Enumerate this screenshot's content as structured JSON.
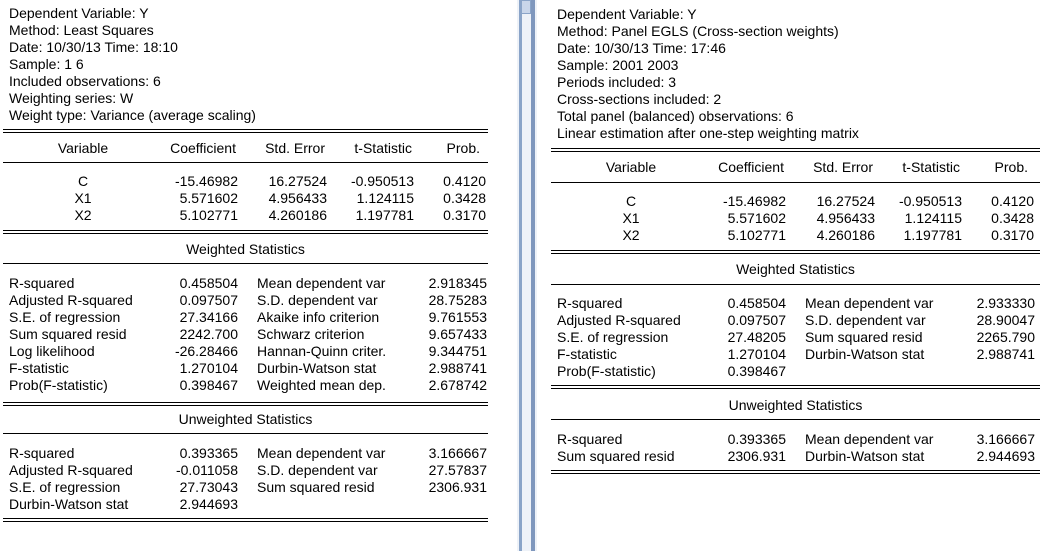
{
  "left": {
    "header": [
      "Dependent Variable: Y",
      "Method: Least Squares",
      "Date: 10/30/13   Time: 18:10",
      "Sample: 1 6",
      "Included observations: 6",
      "Weighting series: W",
      "Weight type: Variance (average scaling)"
    ],
    "columns": [
      "Variable",
      "Coefficient",
      "Std. Error",
      "t-Statistic",
      "Prob."
    ],
    "coef_rows": [
      [
        "C",
        "-15.46982",
        "16.27524",
        "-0.950513",
        "0.4120"
      ],
      [
        "X1",
        "5.571602",
        "4.956433",
        "1.124115",
        "0.3428"
      ],
      [
        "X2",
        "5.102771",
        "4.260186",
        "1.197781",
        "0.3170"
      ]
    ],
    "weighted_title": "Weighted Statistics",
    "weighted_rows": [
      [
        "R-squared",
        "0.458504",
        "Mean dependent var",
        "2.918345"
      ],
      [
        "Adjusted R-squared",
        "0.097507",
        "S.D. dependent var",
        "28.75283"
      ],
      [
        "S.E. of regression",
        "27.34166",
        "Akaike info criterion",
        "9.761553"
      ],
      [
        "Sum squared resid",
        "2242.700",
        "Schwarz criterion",
        "9.657433"
      ],
      [
        "Log likelihood",
        "-26.28466",
        "Hannan-Quinn criter.",
        "9.344751"
      ],
      [
        "F-statistic",
        "1.270104",
        "Durbin-Watson stat",
        "2.988741"
      ],
      [
        "Prob(F-statistic)",
        "0.398467",
        "Weighted mean dep.",
        "2.678742"
      ]
    ],
    "unweighted_title": "Unweighted Statistics",
    "unweighted_rows": [
      [
        "R-squared",
        "0.393365",
        "Mean dependent var",
        "3.166667"
      ],
      [
        "Adjusted R-squared",
        "-0.011058",
        "S.D. dependent var",
        "27.57837"
      ],
      [
        "S.E. of regression",
        "27.73043",
        "Sum squared resid",
        "2306.931"
      ],
      [
        "Durbin-Watson stat",
        "2.944693",
        "",
        ""
      ]
    ]
  },
  "right": {
    "header": [
      "Dependent Variable: Y",
      "Method: Panel EGLS (Cross-section weights)",
      "Date: 10/30/13   Time: 17:46",
      "Sample: 2001 2003",
      "Periods included: 3",
      "Cross-sections included: 2",
      "Total panel (balanced) observations: 6",
      "Linear estimation after one-step weighting matrix"
    ],
    "columns": [
      "Variable",
      "Coefficient",
      "Std. Error",
      "t-Statistic",
      "Prob."
    ],
    "coef_rows": [
      [
        "C",
        "-15.46982",
        "16.27524",
        "-0.950513",
        "0.4120"
      ],
      [
        "X1",
        "5.571602",
        "4.956433",
        "1.124115",
        "0.3428"
      ],
      [
        "X2",
        "5.102771",
        "4.260186",
        "1.197781",
        "0.3170"
      ]
    ],
    "weighted_title": "Weighted Statistics",
    "weighted_rows": [
      [
        "R-squared",
        "0.458504",
        "Mean dependent var",
        "2.933330"
      ],
      [
        "Adjusted R-squared",
        "0.097507",
        "S.D. dependent var",
        "28.90047"
      ],
      [
        "S.E. of regression",
        "27.48205",
        "Sum squared resid",
        "2265.790"
      ],
      [
        "F-statistic",
        "1.270104",
        "Durbin-Watson stat",
        "2.988741"
      ],
      [
        "Prob(F-statistic)",
        "0.398467",
        "",
        ""
      ]
    ],
    "unweighted_title": "Unweighted Statistics",
    "unweighted_rows": [
      [
        "R-squared",
        "0.393365",
        "Mean dependent var",
        "3.166667"
      ],
      [
        "Sum squared resid",
        "2306.931",
        "Durbin-Watson stat",
        "2.944693"
      ]
    ]
  }
}
